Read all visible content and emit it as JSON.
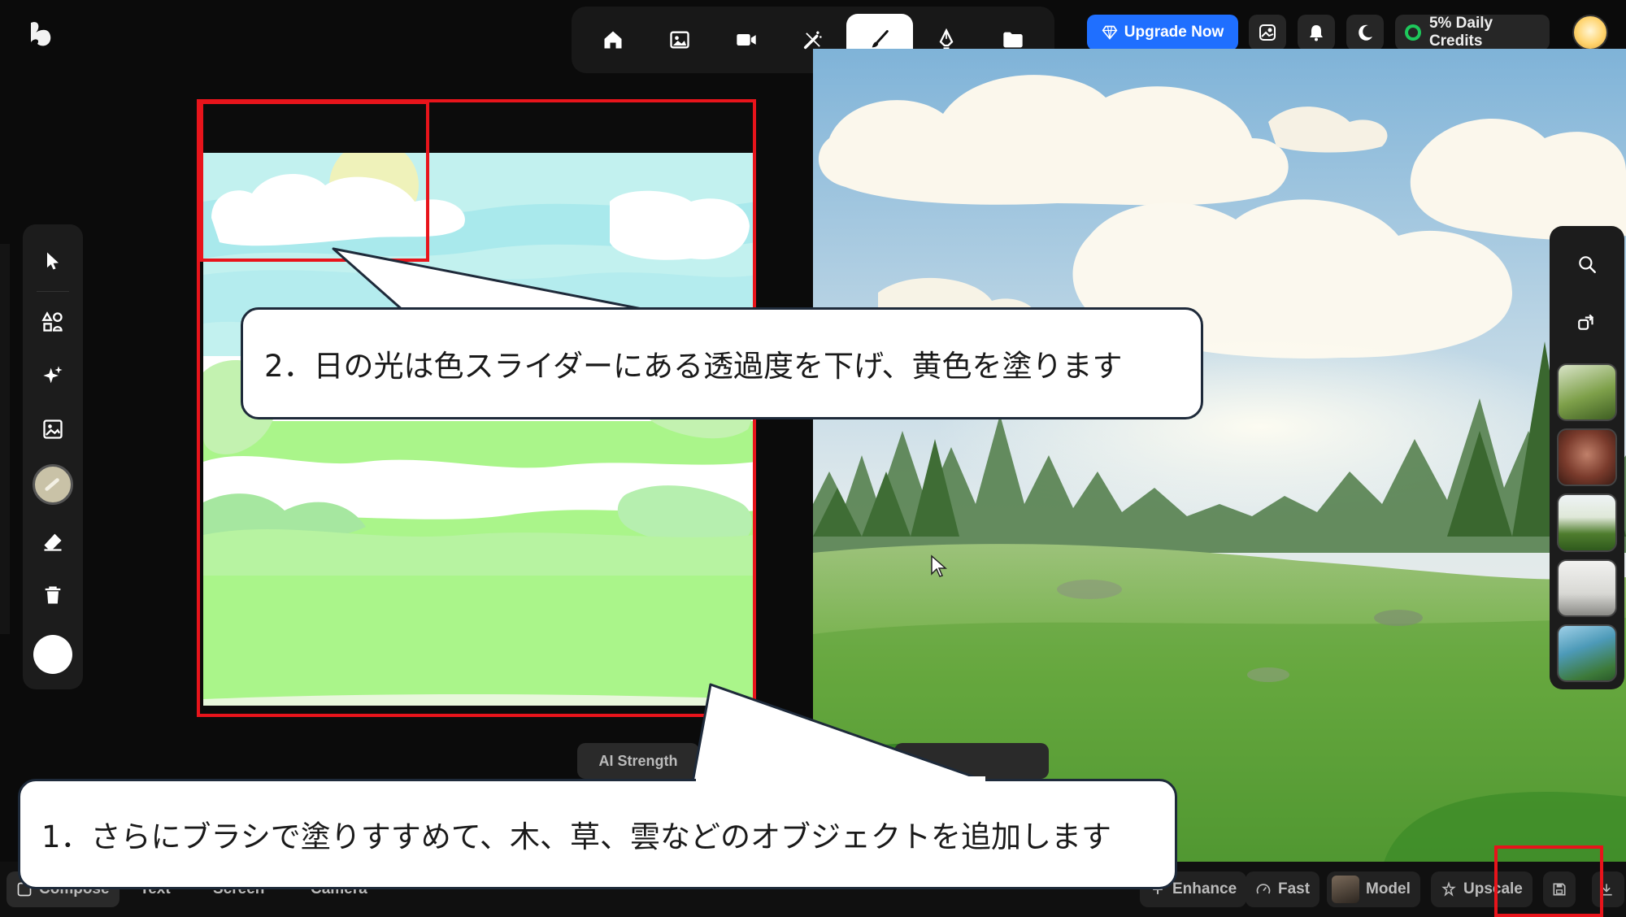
{
  "header": {
    "logo": "k-logo-icon",
    "nav": [
      {
        "name": "home-icon",
        "active": false
      },
      {
        "name": "image-icon",
        "active": false
      },
      {
        "name": "video-icon",
        "active": false
      },
      {
        "name": "magic-wand-icon",
        "active": false
      },
      {
        "name": "brush-icon",
        "active": true
      },
      {
        "name": "pen-nib-icon",
        "active": false
      },
      {
        "name": "folder-icon",
        "active": false
      }
    ],
    "upgrade_label": "Upgrade Now",
    "credits_label": "5% Daily Credits"
  },
  "left_toolbar": {
    "tools": [
      "cursor-icon",
      "shapes-icon",
      "sparkle-icon",
      "image-icon",
      "brush-size-swatch",
      "eraser-icon",
      "trash-icon",
      "color-swatch"
    ],
    "brush_color": "#c9c2a7",
    "paint_color": "#ffffff"
  },
  "controls": {
    "ai_strength_label": "AI Strength"
  },
  "bottom_bar": {
    "items": [
      "Compose",
      "Text",
      "Screen",
      "Camera"
    ],
    "enhance_label": "Enhance",
    "fast_label": "Fast",
    "model_label": "Model",
    "upscale_label": "Upscale"
  },
  "callouts": {
    "step1": "1．さらにブラシで塗りすすめて、木、草、雲などのオブジェクトを追加します",
    "step2": "2．日の光は色スライダーにある透過度を下げ、黄色を塗ります"
  },
  "colors": {
    "accent": "#1f6fff",
    "annotation_red": "#e8141b",
    "credits_ring": "#1ec85b"
  }
}
